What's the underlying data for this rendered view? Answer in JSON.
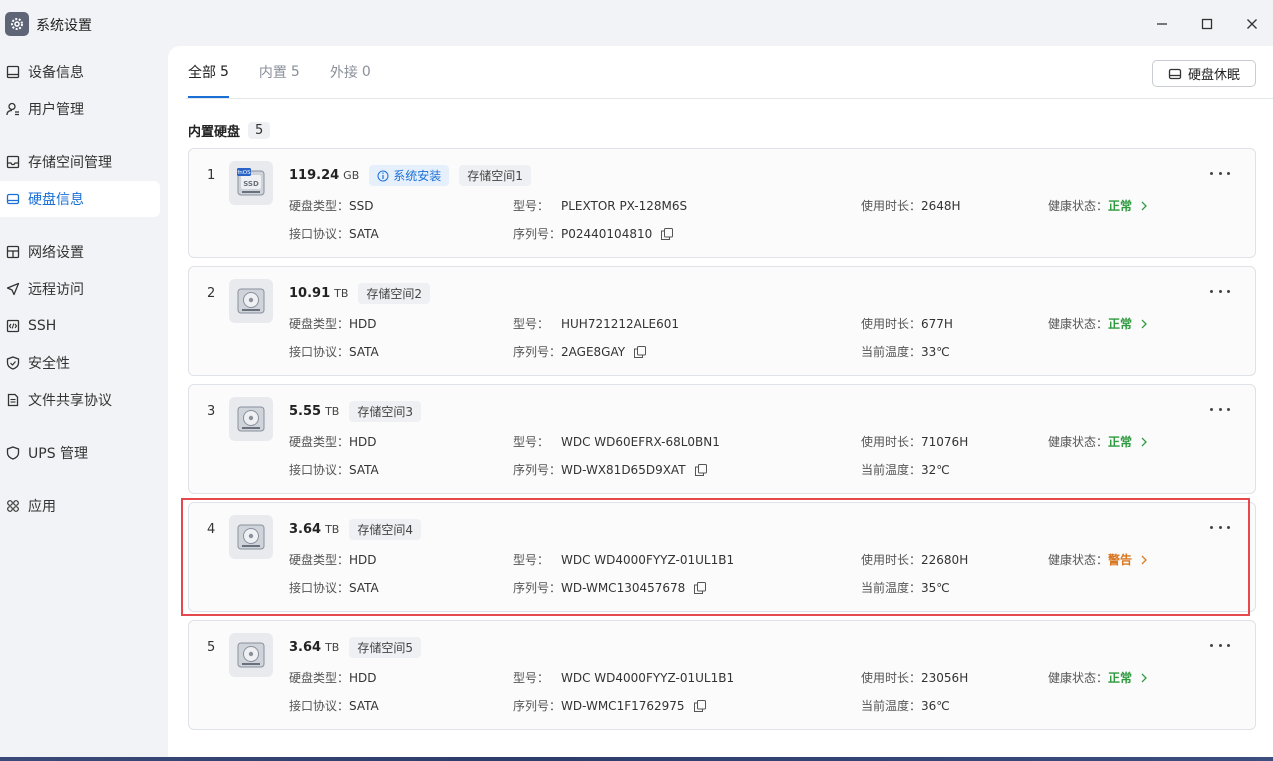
{
  "window": {
    "title": "系统设置"
  },
  "sidebar": {
    "items": [
      {
        "label": "设备信息",
        "icon": "monitor-icon"
      },
      {
        "label": "用户管理",
        "icon": "user-icon"
      },
      {
        "label": "存储空间管理",
        "icon": "storage-icon"
      },
      {
        "label": "硬盘信息",
        "icon": "disk-icon",
        "active": true
      },
      {
        "label": "网络设置",
        "icon": "network-icon"
      },
      {
        "label": "远程访问",
        "icon": "send-icon"
      },
      {
        "label": "SSH",
        "icon": "code-icon"
      },
      {
        "label": "安全性",
        "icon": "shield-icon"
      },
      {
        "label": "文件共享协议",
        "icon": "document-icon"
      },
      {
        "label": "UPS 管理",
        "icon": "ups-shield-icon"
      },
      {
        "label": "应用",
        "icon": "apps-icon"
      }
    ]
  },
  "tabs": [
    {
      "label": "全部",
      "count": "5",
      "active": true
    },
    {
      "label": "内置",
      "count": "5"
    },
    {
      "label": "外接",
      "count": "0"
    }
  ],
  "toolbar": {
    "sleep_label": "硬盘休眠"
  },
  "section": {
    "title": "内置硬盘",
    "count": "5"
  },
  "labels": {
    "type": "硬盘类型：",
    "protocol": "接口协议：",
    "model": "型号：",
    "serial": "序列号：",
    "hours": "使用时长：",
    "temp": "当前温度：",
    "health": "健康状态："
  },
  "disks": [
    {
      "index": "1",
      "capacity": "119.24",
      "unit": "GB",
      "system_tag": "系统安装",
      "pool": "存储空间1",
      "type": "SSD",
      "protocol": "SATA",
      "model": "PLEXTOR PX-128M6S",
      "serial": "P02440104810",
      "hours": "2648H",
      "temp": "",
      "health": "正常",
      "ssd_badge": "fnOS"
    },
    {
      "index": "2",
      "capacity": "10.91",
      "unit": "TB",
      "pool": "存储空间2",
      "type": "HDD",
      "protocol": "SATA",
      "model": "HUH721212ALE601",
      "serial": "2AGE8GAY",
      "hours": "677H",
      "temp": "33℃",
      "health": "正常"
    },
    {
      "index": "3",
      "capacity": "5.55",
      "unit": "TB",
      "pool": "存储空间3",
      "type": "HDD",
      "protocol": "SATA",
      "model": "WDC WD60EFRX-68L0BN1",
      "serial": "WD-WX81D65D9XAT",
      "hours": "71076H",
      "temp": "32℃",
      "health": "正常"
    },
    {
      "index": "4",
      "capacity": "3.64",
      "unit": "TB",
      "pool": "存储空间4",
      "type": "HDD",
      "protocol": "SATA",
      "model": "WDC WD4000FYYZ-01UL1B1",
      "serial": "WD-WMC130457678",
      "hours": "22680H",
      "temp": "35℃",
      "health": "警告"
    },
    {
      "index": "5",
      "capacity": "3.64",
      "unit": "TB",
      "pool": "存储空间5",
      "type": "HDD",
      "protocol": "SATA",
      "model": "WDC WD4000FYYZ-01UL1B1",
      "serial": "WD-WMC1F1762975",
      "hours": "23056H",
      "temp": "36℃",
      "health": "正常"
    }
  ],
  "colors": {
    "accent": "#1a6fd6",
    "healthy": "#2e9a3f",
    "warning": "#d9771f",
    "highlight": "#e5484d"
  }
}
